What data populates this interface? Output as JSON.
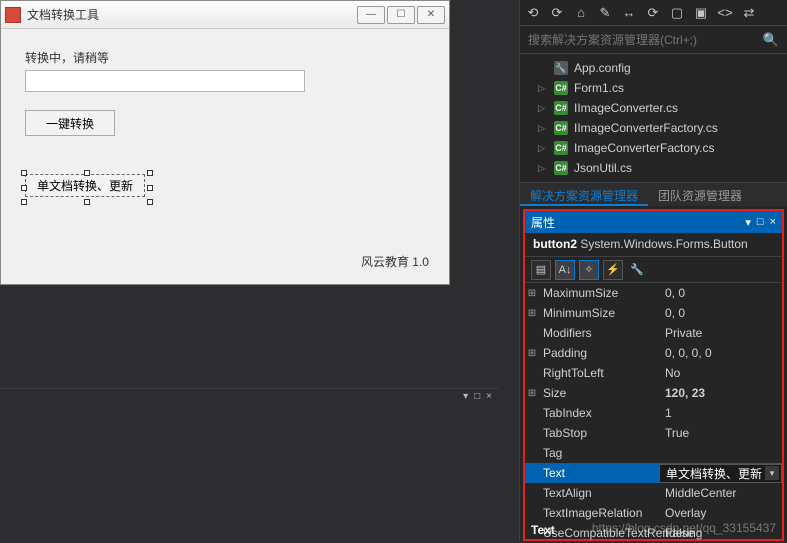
{
  "form": {
    "title": "文档转换工具",
    "status_label": "转换中，请稍等",
    "convert_button": "一键转换",
    "selected_button": "单文档转换、更新",
    "footer": "风云教育 1.0"
  },
  "toolbar_icons": [
    "⟲",
    "⟳",
    "⌂",
    "✎",
    "↔",
    "⟳",
    "▢",
    "▣",
    "<>",
    "⇄"
  ],
  "search": {
    "placeholder": "搜索解决方案资源管理器(Ctrl+;)"
  },
  "tree": [
    {
      "icon": "wrench",
      "label": "App.config",
      "arrow": ""
    },
    {
      "icon": "cs",
      "label": "Form1.cs",
      "arrow": "▷"
    },
    {
      "icon": "cs",
      "label": "IImageConverter.cs",
      "arrow": "▷"
    },
    {
      "icon": "cs",
      "label": "IImageConverterFactory.cs",
      "arrow": "▷"
    },
    {
      "icon": "cs",
      "label": "ImageConverterFactory.cs",
      "arrow": "▷"
    },
    {
      "icon": "cs",
      "label": "JsonUtil.cs",
      "arrow": "▷"
    }
  ],
  "tabs": {
    "active": "解决方案资源管理器",
    "other": "团队资源管理器"
  },
  "props": {
    "title": "属性",
    "object_name": "button2",
    "object_type": "System.Windows.Forms.Button",
    "rows": [
      {
        "exp": "⊞",
        "name": "MaximumSize",
        "value": "0, 0"
      },
      {
        "exp": "⊞",
        "name": "MinimumSize",
        "value": "0, 0"
      },
      {
        "exp": "",
        "name": "Modifiers",
        "value": "Private"
      },
      {
        "exp": "⊞",
        "name": "Padding",
        "value": "0, 0, 0, 0"
      },
      {
        "exp": "",
        "name": "RightToLeft",
        "value": "No"
      },
      {
        "exp": "⊞",
        "name": "Size",
        "value": "120, 23",
        "bold": true
      },
      {
        "exp": "",
        "name": "TabIndex",
        "value": "1"
      },
      {
        "exp": "",
        "name": "TabStop",
        "value": "True"
      },
      {
        "exp": "",
        "name": "Tag",
        "value": ""
      },
      {
        "exp": "",
        "name": "Text",
        "value": "单文档转换、更新",
        "selected": true
      },
      {
        "exp": "",
        "name": "TextAlign",
        "value": "MiddleCenter"
      },
      {
        "exp": "",
        "name": "TextImageRelation",
        "value": "Overlay"
      },
      {
        "exp": "",
        "name": "UseCompatibleTextRendering",
        "value": "False"
      }
    ],
    "footer": "Text"
  },
  "watermark": "https://blog.csdn.net/qq_33155437",
  "bottom_panel_controls": [
    "▾",
    "□",
    "×"
  ]
}
